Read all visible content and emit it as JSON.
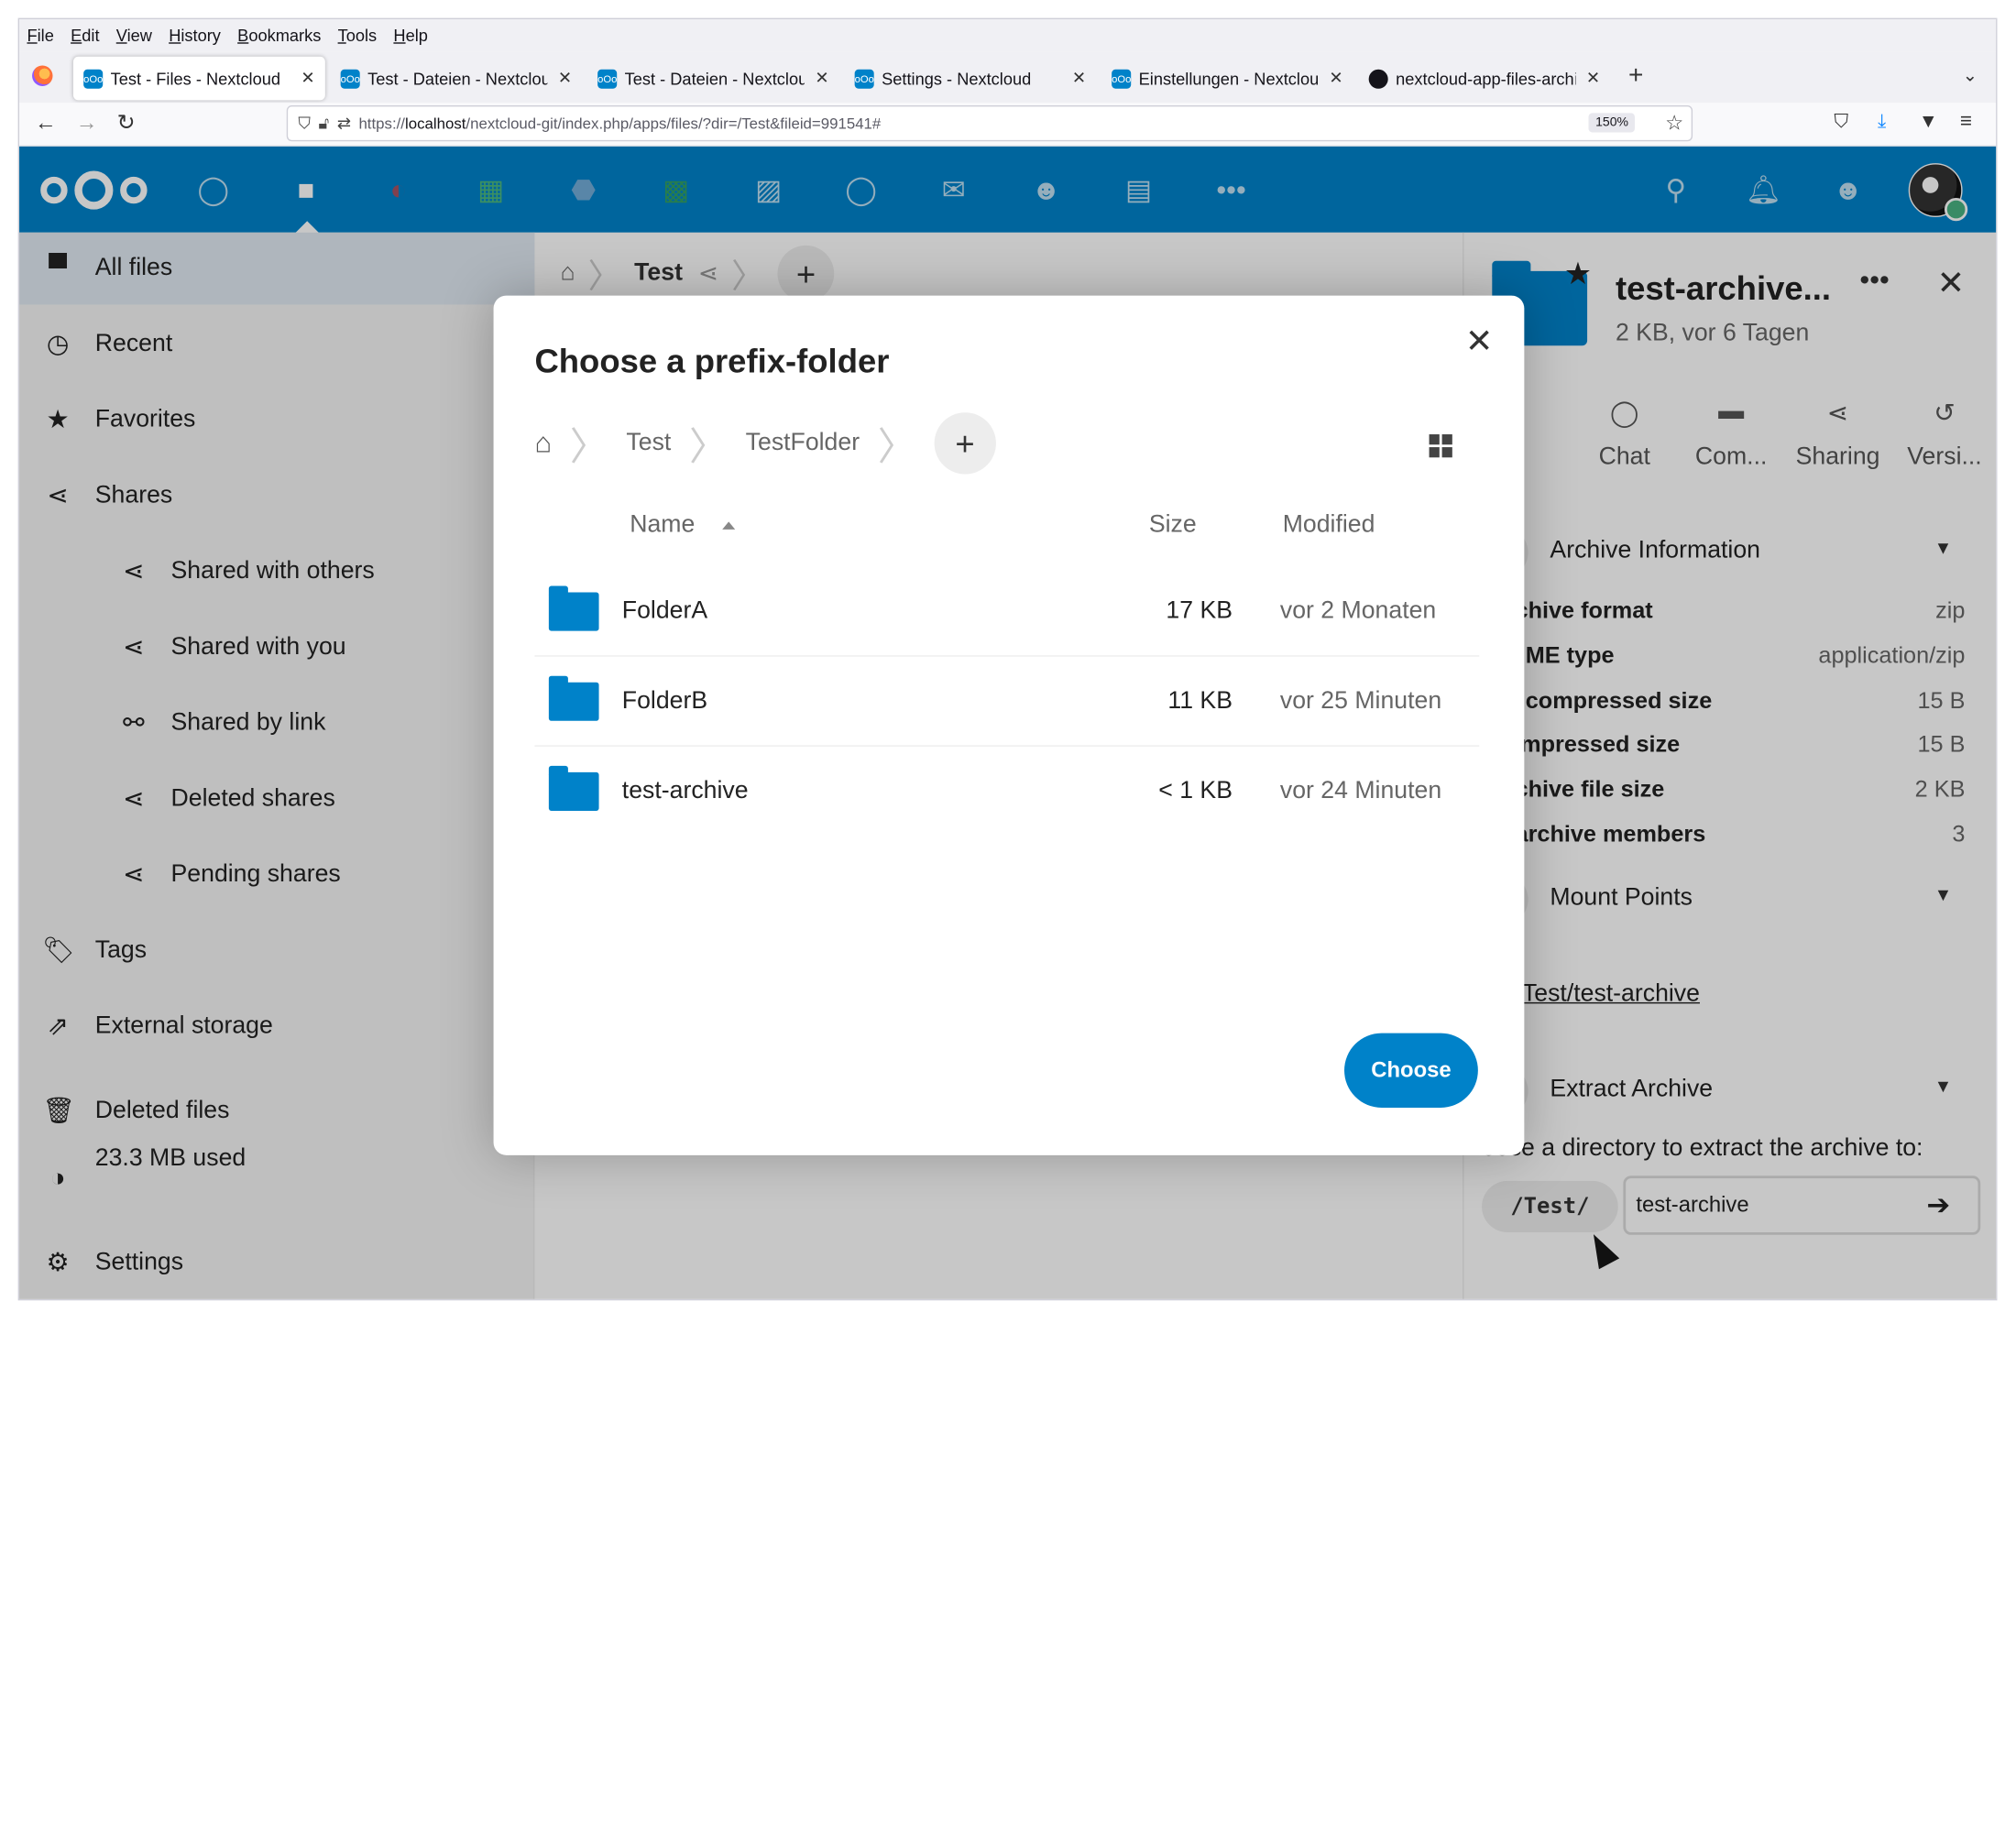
{
  "browser": {
    "menu": [
      "File",
      "Edit",
      "View",
      "History",
      "Bookmarks",
      "Tools",
      "Help"
    ],
    "tabs": [
      {
        "title": "Test - Files - Nextcloud",
        "active": true
      },
      {
        "title": "Test - Dateien - Nextcloud"
      },
      {
        "title": "Test - Dateien - Nextcloud"
      },
      {
        "title": "Settings - Nextcloud"
      },
      {
        "title": "Einstellungen - Nextcloud"
      },
      {
        "title": "nextcloud-app-files-archive"
      }
    ],
    "url_prefix": "https://",
    "url_host": "localhost",
    "url_rest": "/nextcloud-git/index.php/apps/files/?dir=/Test&fileid=991541#",
    "zoom": "150%"
  },
  "sidebar": {
    "items": [
      {
        "label": "All files",
        "icon": "folder-icon"
      },
      {
        "label": "Recent",
        "icon": "clock-icon"
      },
      {
        "label": "Favorites",
        "icon": "star-icon"
      },
      {
        "label": "Shares",
        "icon": "share-icon"
      },
      {
        "label": "Shared with others",
        "icon": "share-icon"
      },
      {
        "label": "Shared with you",
        "icon": "share-icon"
      },
      {
        "label": "Shared by link",
        "icon": "link-icon"
      },
      {
        "label": "Deleted shares",
        "icon": "share-icon"
      },
      {
        "label": "Pending shares",
        "icon": "share-icon"
      },
      {
        "label": "Tags",
        "icon": "tag-icon"
      },
      {
        "label": "External storage",
        "icon": "external-icon"
      },
      {
        "label": "Deleted files",
        "icon": "trash-icon"
      },
      {
        "label": "23.3 MB used",
        "icon": "quota-icon"
      },
      {
        "label": "Settings",
        "icon": "gear-icon"
      }
    ]
  },
  "main": {
    "breadcrumb": "Test"
  },
  "details": {
    "title": "test-archive...",
    "subtitle": "2 KB, vor 6 Tagen",
    "tabs": [
      "ive",
      "Chat",
      "Com...",
      "Sharing",
      "Versi..."
    ],
    "archive_info_title": "Archive Information",
    "rows": [
      {
        "key": "chive format",
        "value": "zip"
      },
      {
        "key": "ME type",
        "value": "application/zip"
      },
      {
        "key": "compressed size",
        "value": "15 B"
      },
      {
        "key": "mpressed size",
        "value": "15 B"
      },
      {
        "key": "chive file size",
        "value": "2 KB"
      },
      {
        "key": "archive members",
        "value": "3"
      }
    ],
    "mount_title": "Mount Points",
    "mount_link": "/Test/test-archive",
    "extract_title": "Extract Archive",
    "extract_label": "oose a directory to extract the archive to:",
    "extract_prefix": "/Test/",
    "extract_value": "test-archive"
  },
  "modal": {
    "title": "Choose a prefix-folder",
    "crumbs": [
      "Test",
      "TestFolder"
    ],
    "columns": {
      "name": "Name",
      "size": "Size",
      "modified": "Modified"
    },
    "files": [
      {
        "name": "FolderA",
        "size": "17 KB",
        "modified": "vor 2 Monaten"
      },
      {
        "name": "FolderB",
        "size": "11 KB",
        "modified": "vor 25 Minuten"
      },
      {
        "name": "test-archive",
        "size": "< 1 KB",
        "modified": "vor 24 Minuten"
      }
    ],
    "choose_label": "Choose"
  },
  "colors": {
    "primary": "#0082c9",
    "status_online": "#49b382"
  }
}
